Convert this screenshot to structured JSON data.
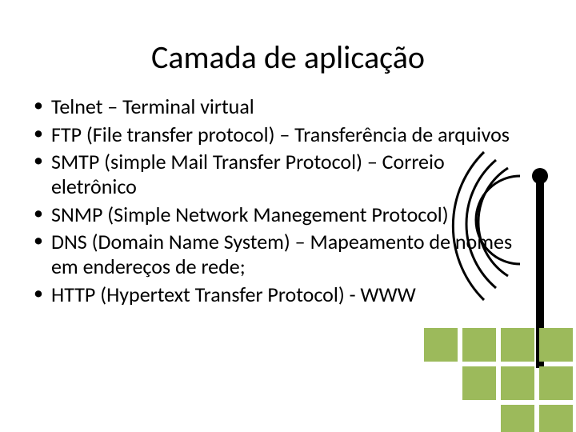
{
  "title": "Camada de aplicação",
  "bullets": [
    "Telnet – Terminal virtual",
    "FTP (File transfer protocol) – Transferência de arquivos",
    "SMTP (simple Mail Transfer Protocol) – Correio eletrônico",
    "SNMP (Simple Network Manegement Protocol)",
    "DNS (Domain Name System) – Mapeamento de nomes em endereços de rede;",
    "HTTP (Hypertext Transfer Protocol) - WWW"
  ]
}
